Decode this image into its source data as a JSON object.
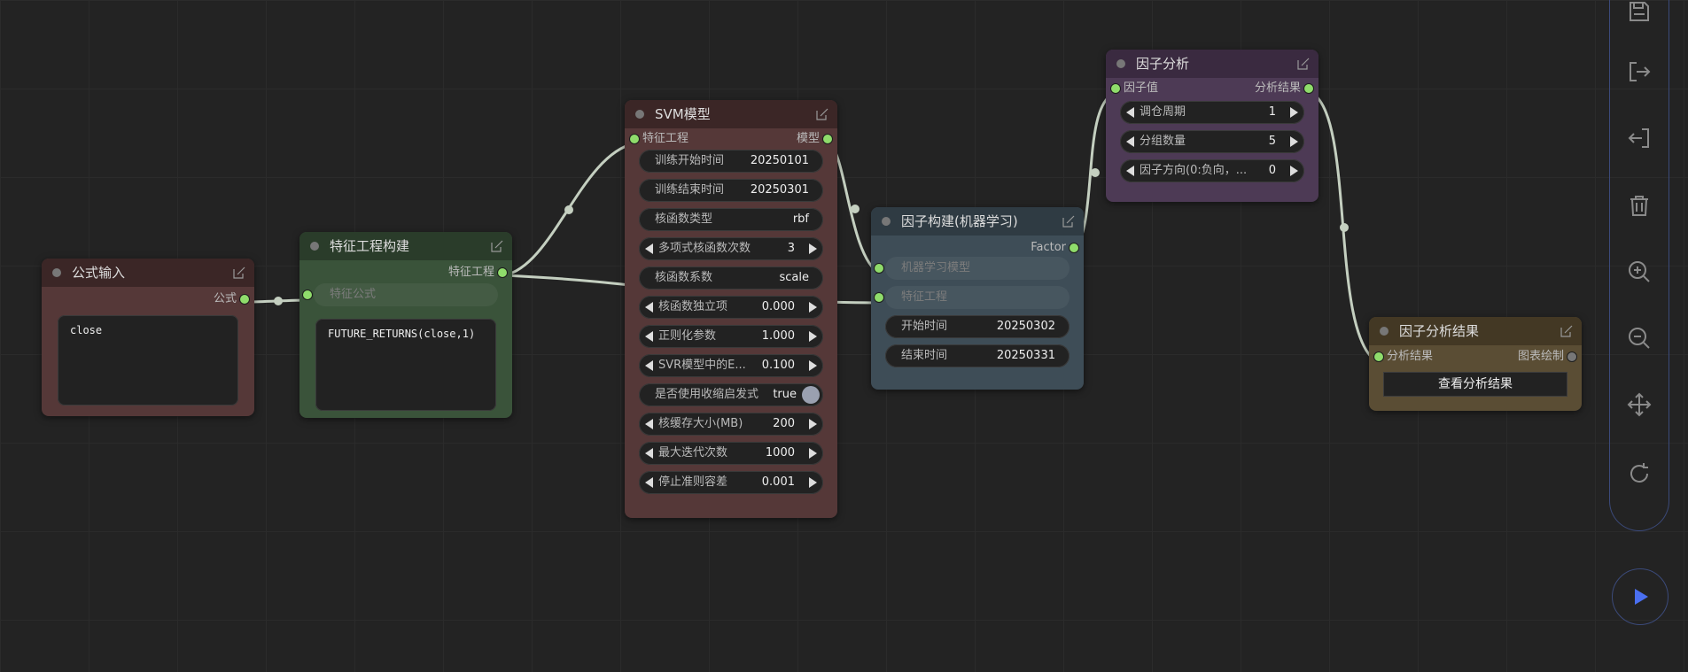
{
  "nodes": {
    "formula_input": {
      "title": "公式输入",
      "output_label": "公式",
      "text": "close"
    },
    "feature_eng": {
      "title": "特征工程构建",
      "output_label": "特征工程",
      "input_placeholder": "特征公式",
      "text": "FUTURE_RETURNS(close,1)"
    },
    "svm": {
      "title": "SVM模型",
      "input_label": "特征工程",
      "output_label": "模型",
      "params": [
        {
          "label": "训练开始时间",
          "value": "20250101",
          "kind": "text"
        },
        {
          "label": "训练结束时间",
          "value": "20250301",
          "kind": "text"
        },
        {
          "label": "核函数类型",
          "value": "rbf",
          "kind": "text"
        },
        {
          "label": "多项式核函数次数",
          "value": "3",
          "kind": "number"
        },
        {
          "label": "核函数系数",
          "value": "scale",
          "kind": "text"
        },
        {
          "label": "核函数独立项",
          "value": "0.000",
          "kind": "number"
        },
        {
          "label": "正则化参数",
          "value": "1.000",
          "kind": "number"
        },
        {
          "label": "SVR模型中的E...",
          "value": "0.100",
          "kind": "number"
        },
        {
          "label": "是否使用收缩启发式",
          "value": "true",
          "kind": "toggle"
        },
        {
          "label": "核缓存大小(MB)",
          "value": "200",
          "kind": "number"
        },
        {
          "label": "最大迭代次数",
          "value": "1000",
          "kind": "number"
        },
        {
          "label": "停止准则容差",
          "value": "0.001",
          "kind": "number"
        }
      ]
    },
    "factor_ml": {
      "title": "因子构建(机器学习)",
      "output_label": "Factor",
      "inputs": [
        "机器学习模型",
        "特征工程"
      ],
      "params": [
        {
          "label": "开始时间",
          "value": "20250302"
        },
        {
          "label": "结束时间",
          "value": "20250331"
        }
      ]
    },
    "factor_analysis": {
      "title": "因子分析",
      "input_label": "因子值",
      "output_label": "分析结果",
      "params": [
        {
          "label": "调仓周期",
          "value": "1"
        },
        {
          "label": "分组数量",
          "value": "5"
        },
        {
          "label": "因子方向(0:负向，...",
          "value": "0"
        }
      ]
    },
    "factor_result": {
      "title": "因子分析结果",
      "input_label": "分析结果",
      "output_label": "图表绘制",
      "button": "查看分析结果"
    }
  },
  "colors": {
    "link": "#c4cfc0",
    "port": "#8fdc6b",
    "accent": "#4a6ff0"
  },
  "sidebar_icons": [
    "save-icon",
    "export-icon",
    "import-icon",
    "trash-icon",
    "zoom-in-icon",
    "zoom-out-icon",
    "move-icon",
    "refresh-icon"
  ],
  "run_icon": "play-icon"
}
